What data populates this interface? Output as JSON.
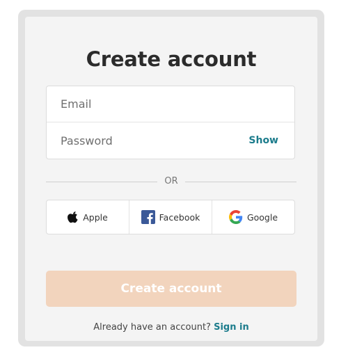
{
  "form": {
    "title": "Create account",
    "email": {
      "value": "",
      "placeholder": "Email"
    },
    "password": {
      "value": "",
      "placeholder": "Password",
      "toggle_label": "Show"
    },
    "divider_label": "OR",
    "social": [
      {
        "label": "Apple",
        "icon": "apple-icon"
      },
      {
        "label": "Facebook",
        "icon": "facebook-icon"
      },
      {
        "label": "Google",
        "icon": "google-icon"
      }
    ],
    "submit_label": "Create account",
    "footer": {
      "prompt": "Already have an account?",
      "link": "Sign in"
    }
  },
  "colors": {
    "accent_link": "#1c7c8c",
    "submit_disabled": "#f2d4bd",
    "card_background": "#f4f4f4",
    "frame_background": "#e2e2e2",
    "facebook_blue": "#3b5998"
  }
}
